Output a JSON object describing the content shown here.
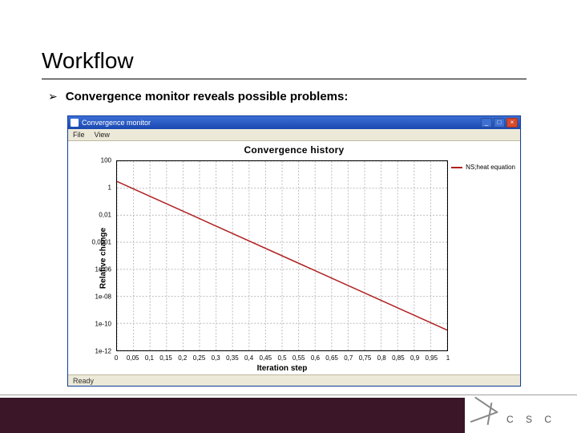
{
  "slide": {
    "title": "Workflow",
    "bullet": "Convergence monitor reveals possible problems:"
  },
  "window": {
    "title": "Convergence monitor",
    "menu": {
      "file": "File",
      "view": "View"
    },
    "status": "Ready",
    "buttons": {
      "min": "_",
      "max": "□",
      "close": "×"
    }
  },
  "footer": {
    "logo_text": "C S C"
  },
  "chart_data": {
    "type": "line",
    "title": "Convergence history",
    "xlabel": "Iteration step",
    "ylabel": "Relative change",
    "xlim": [
      0,
      1
    ],
    "ylim_log10": [
      -12,
      2
    ],
    "xticks": [
      0,
      0.05,
      0.1,
      0.15,
      0.2,
      0.25,
      0.3,
      0.35,
      0.4,
      0.45,
      0.5,
      0.55,
      0.6,
      0.65,
      0.7,
      0.75,
      0.8,
      0.85,
      0.9,
      0.95,
      1
    ],
    "xtick_labels": [
      "0",
      "0,05",
      "0,1",
      "0,15",
      "0,2",
      "0,25",
      "0,3",
      "0,35",
      "0,4",
      "0,45",
      "0,5",
      "0,55",
      "0,6",
      "0,65",
      "0,7",
      "0,75",
      "0,8",
      "0,85",
      "0,9",
      "0,95",
      "1"
    ],
    "ytick_log10": [
      2,
      0,
      -2,
      -4,
      -6,
      -8,
      -10,
      -12
    ],
    "ytick_labels": [
      "100",
      "1",
      "0,01",
      "0,0001",
      "1e-06",
      "1e-08",
      "1e-10",
      "1e-12"
    ],
    "series": [
      {
        "name": "NS;heat equation",
        "x": [
          0,
          1
        ],
        "y_log10": [
          0.5,
          -10.5
        ]
      }
    ]
  }
}
